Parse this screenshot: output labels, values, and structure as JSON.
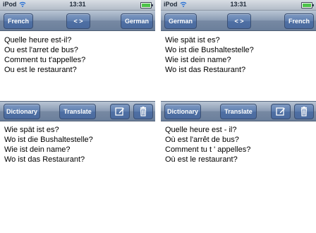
{
  "colors": {
    "battery": "#4dc34a",
    "button": "#4f70a4"
  },
  "panes": {
    "left": {
      "status": {
        "carrier": "iPod",
        "time": "13:31",
        "battery_level": 1.0
      },
      "nav": {
        "source_label": "French",
        "swap_label": "< >",
        "target_label": "German"
      },
      "input_lines": [
        "Quelle heure est-il?",
        "Ou est l'arret de bus?",
        "Comment tu t'appelles?",
        "Ou est le restaurant?"
      ],
      "toolbar": {
        "dictionary_label": "Dictionary",
        "translate_label": "Translate",
        "edit_icon": "edit-icon",
        "trash_icon": "trash-icon"
      },
      "output_lines": [
        "Wie spät ist es?",
        "Wo ist die Bushaltestelle?",
        "Wie ist dein name?",
        "Wo ist das Restaurant?"
      ]
    },
    "right": {
      "status": {
        "carrier": "iPod",
        "time": "13:31",
        "battery_level": 1.0
      },
      "nav": {
        "source_label": "German",
        "swap_label": "< >",
        "target_label": "French"
      },
      "input_lines": [
        "Wie spät ist es?",
        "Wo ist die Bushaltestelle?",
        "Wie ist dein name?",
        "Wo ist das Restaurant?"
      ],
      "toolbar": {
        "dictionary_label": "Dictionary",
        "translate_label": "Translate",
        "edit_icon": "edit-icon",
        "trash_icon": "trash-icon"
      },
      "output_lines": [
        "Quelle heure est - il?",
        "Où est l'arrêt de bus?",
        "Comment tu t ' appelles?",
        "Où est le restaurant?"
      ]
    }
  }
}
